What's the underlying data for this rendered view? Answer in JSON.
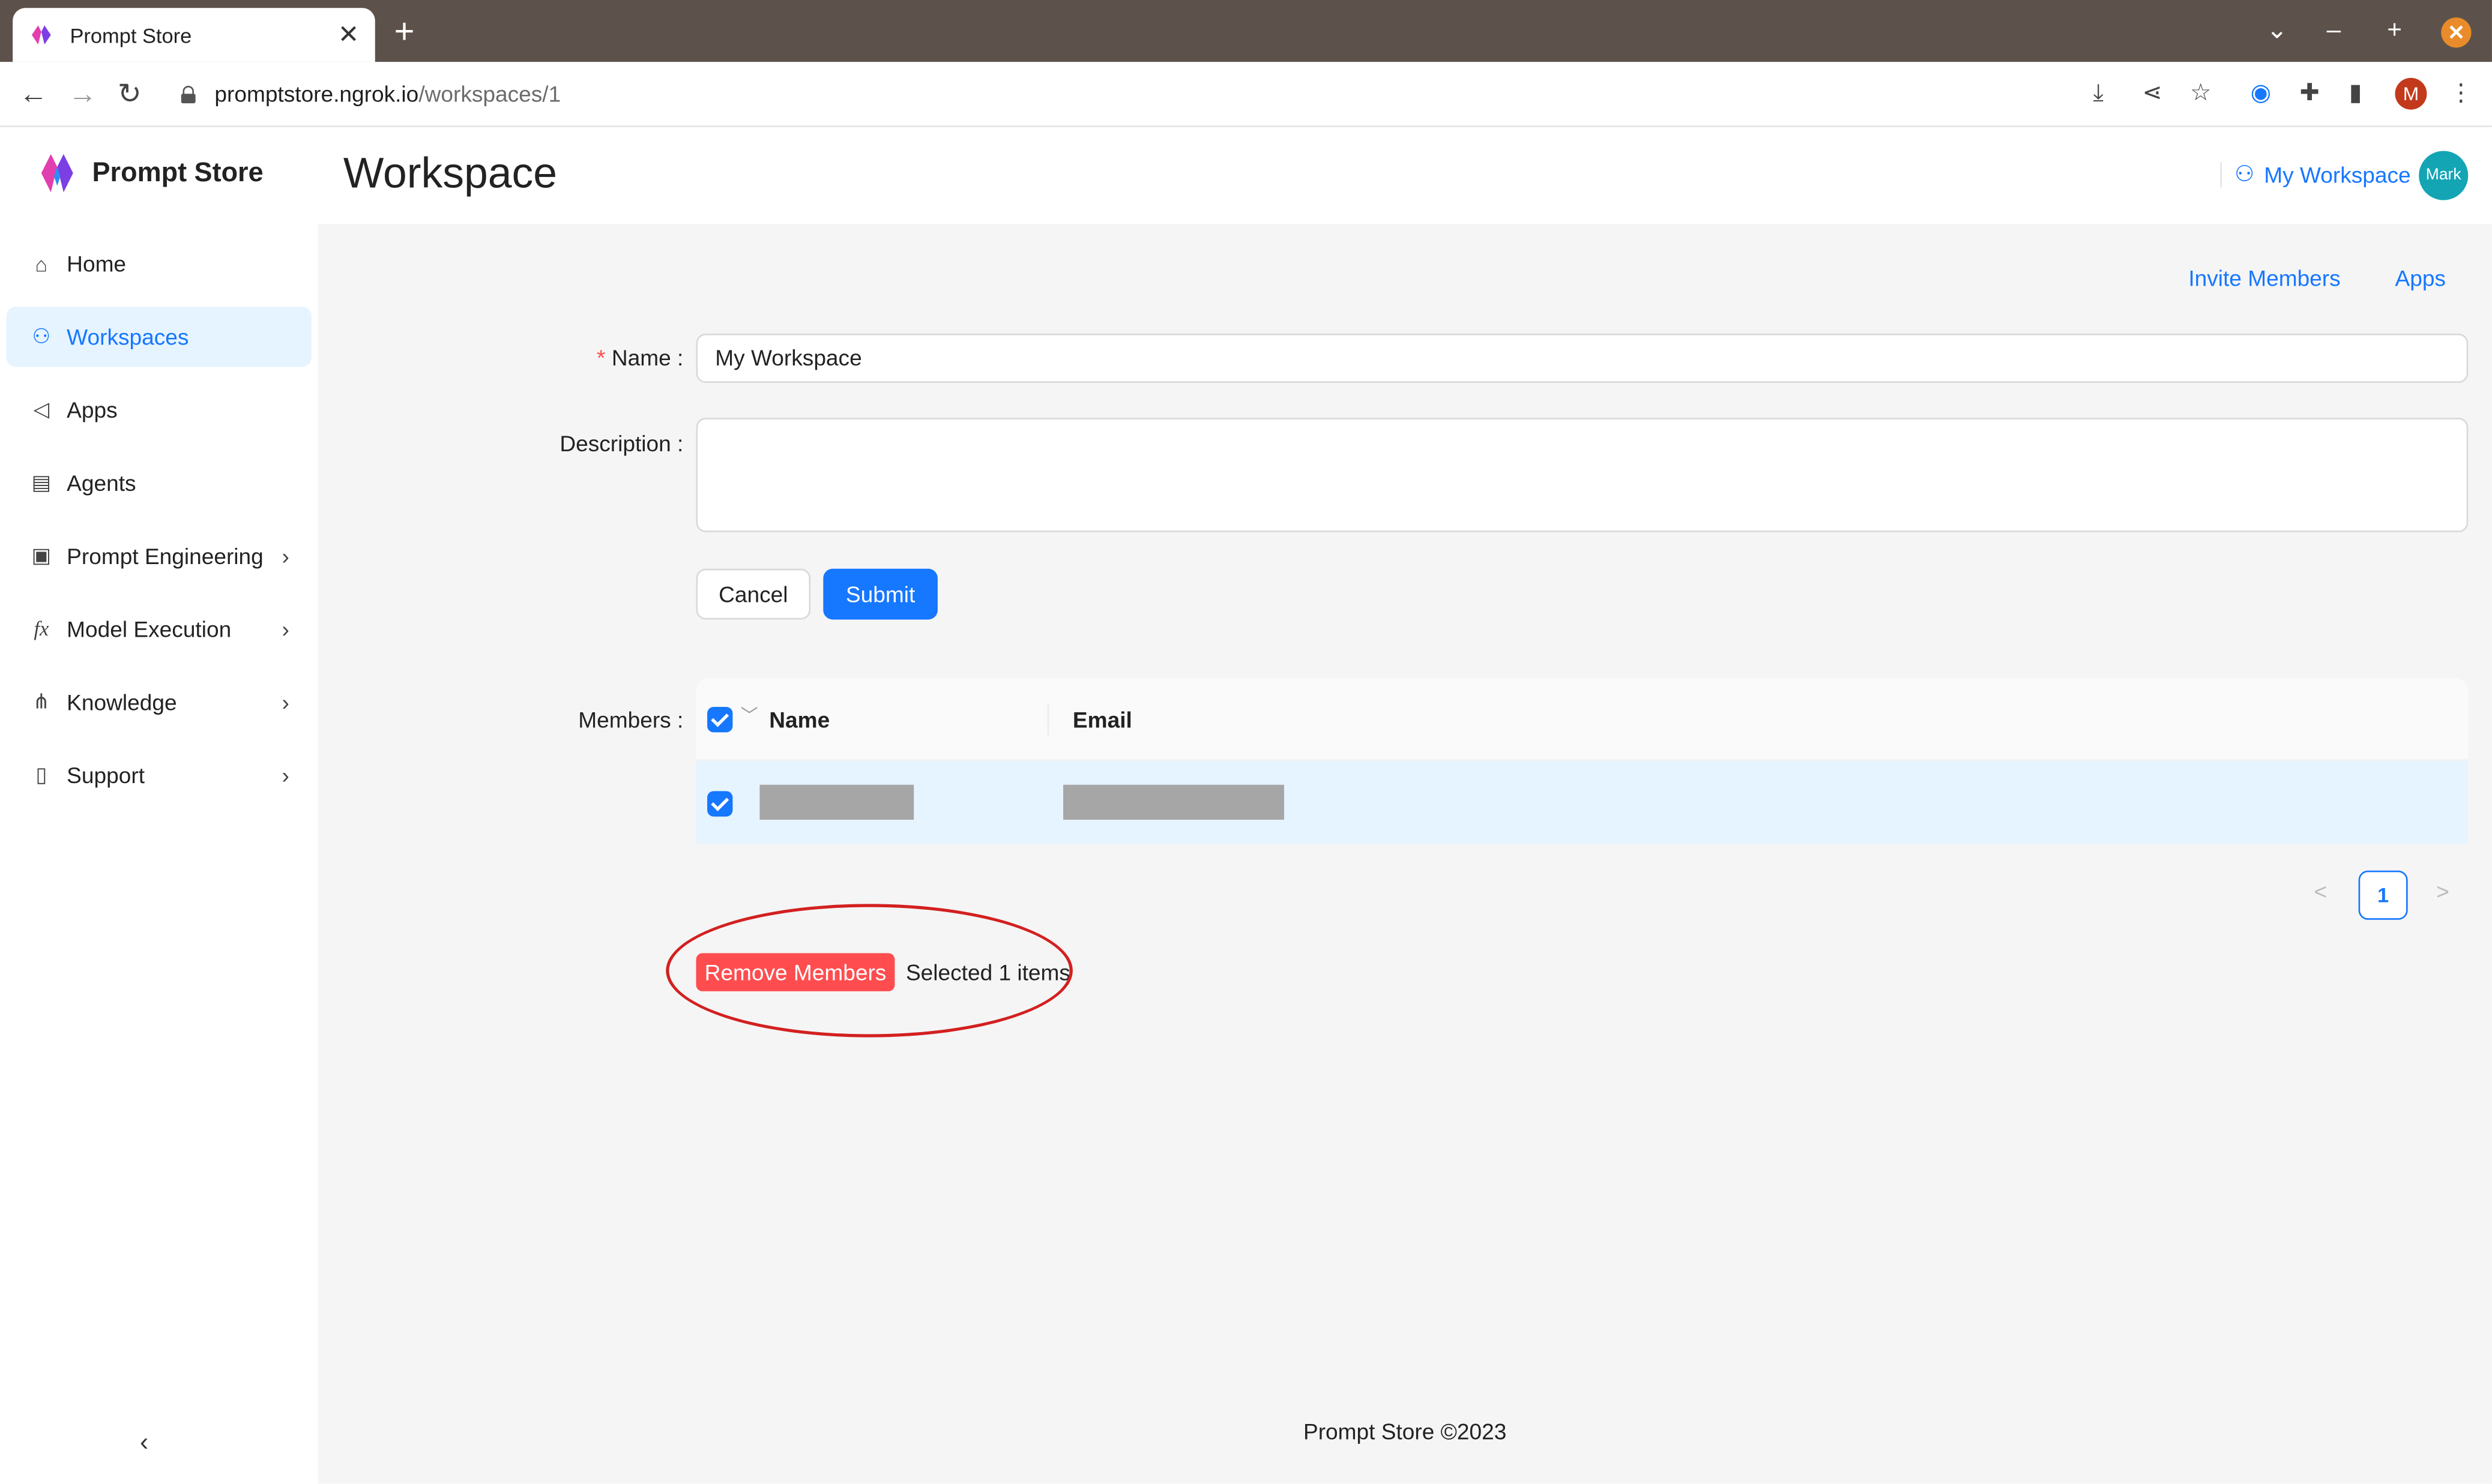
{
  "browser": {
    "tab_title": "Prompt Store",
    "tab_close": "✕",
    "new_tab": "+",
    "url_host": "promptstore.ngrok.io",
    "url_path": "/workspaces/1",
    "profile_initial": "M",
    "window_controls": {
      "tab_search": "⌄",
      "minimize": "–",
      "maximize": "+",
      "close": "✕"
    },
    "accent_colors": {
      "tabbar": "#5c524b",
      "close": "#e98b2a",
      "profile": "#c2391b"
    }
  },
  "sidebar": {
    "brand": "Prompt Store",
    "items": [
      {
        "label": "Home",
        "icon": "home-icon",
        "active": false,
        "has_children": false
      },
      {
        "label": "Workspaces",
        "icon": "team-icon",
        "active": true,
        "has_children": false
      },
      {
        "label": "Apps",
        "icon": "megaphone-icon",
        "active": false,
        "has_children": false
      },
      {
        "label": "Agents",
        "icon": "agent-icon",
        "active": false,
        "has_children": false
      },
      {
        "label": "Prompt Engineering",
        "icon": "terminal-icon",
        "active": false,
        "has_children": true
      },
      {
        "label": "Model Execution",
        "icon": "function-icon",
        "active": false,
        "has_children": true
      },
      {
        "label": "Knowledge",
        "icon": "nodes-icon",
        "active": false,
        "has_children": true
      },
      {
        "label": "Support",
        "icon": "book-icon",
        "active": false,
        "has_children": true
      }
    ],
    "collapse_label": "‹"
  },
  "header": {
    "title": "Workspace",
    "workspace_link": "My Workspace",
    "avatar_text": "Mark",
    "avatar_color": "#14a5b5"
  },
  "content": {
    "links": {
      "invite": "Invite Members",
      "apps": "Apps"
    },
    "form": {
      "required_mark": "*",
      "name_label": "Name",
      "name_value": "My Workspace",
      "description_label": "Description",
      "description_value": "",
      "cancel": "Cancel",
      "submit": "Submit"
    },
    "members": {
      "label": "Members",
      "columns": [
        "Name",
        "Email"
      ],
      "rows": [
        {
          "name": "",
          "email": "",
          "selected": true,
          "redacted": true
        }
      ]
    },
    "pagination": {
      "prev": "<",
      "current": "1",
      "next": ">"
    },
    "actions": {
      "remove": "Remove Members",
      "selected_text": "Selected 1 items"
    },
    "footer": "Prompt Store ©2023"
  },
  "colors": {
    "primary": "#1677ff",
    "danger": "#ff4d4f",
    "annotation": "#d32020",
    "active_bg": "#e6f4ff"
  }
}
